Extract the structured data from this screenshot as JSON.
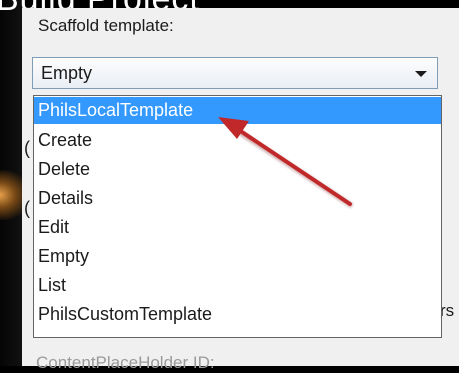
{
  "heading_cutoff": "Build Project",
  "scaffold": {
    "label": "Scaffold template:",
    "selected_value": "Empty",
    "options": [
      "PhilsLocalTemplate",
      "Create",
      "Delete",
      "Details",
      "Edit",
      "Empty",
      "List",
      "PhilsCustomTemplate"
    ],
    "highlighted_index": 0
  },
  "background": {
    "partial_letter_1": "(",
    "partial_letter_2": "(",
    "right_fragment": "rs",
    "bottom_label": "ContentPlaceHolder ID:"
  },
  "colors": {
    "highlight": "#3399ff",
    "arrow": "#c0282a"
  }
}
